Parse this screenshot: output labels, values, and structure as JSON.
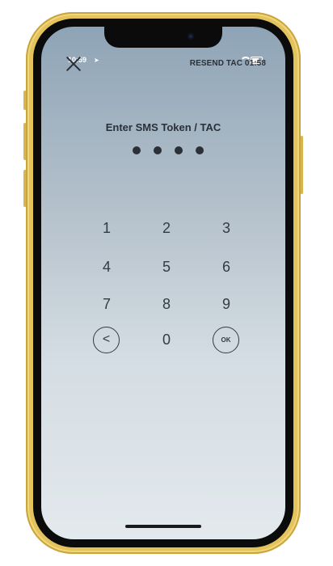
{
  "status_bar": {
    "time": "10:59",
    "location_icon": "location-arrow-icon"
  },
  "header": {
    "close_icon": "close-icon",
    "resend_label": "RESEND TAC 01:58"
  },
  "main": {
    "title": "Enter SMS Token / TAC",
    "pin_entered_count": 4,
    "keypad": {
      "row1": [
        "1",
        "2",
        "3"
      ],
      "row2": [
        "4",
        "5",
        "6"
      ],
      "row3": [
        "7",
        "8",
        "9"
      ],
      "zero": "0",
      "back_icon": "chevron-left-icon",
      "ok_label": "OK"
    }
  }
}
